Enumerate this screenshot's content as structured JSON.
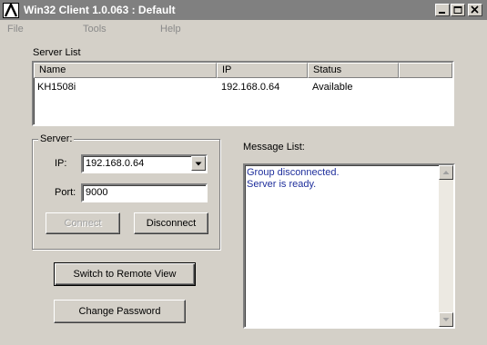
{
  "window": {
    "title": "Win32 Client 1.0.063 : Default"
  },
  "menu": {
    "file": "File",
    "tools": "Tools",
    "help": "Help"
  },
  "server_list": {
    "label": "Server List",
    "columns": [
      "Name",
      "IP",
      "Status"
    ],
    "rows": [
      {
        "name": "KH1508i",
        "ip": "192.168.0.64",
        "status": "Available"
      }
    ]
  },
  "server": {
    "group_label": "Server:",
    "ip_label": "IP:",
    "ip_value": "192.168.0.64",
    "port_label": "Port:",
    "port_value": "9000",
    "connect_label": "Connect",
    "disconnect_label": "Disconnect"
  },
  "buttons": {
    "switch_remote": "Switch to Remote View",
    "change_password": "Change Password"
  },
  "messages": {
    "label": "Message List:",
    "lines": [
      "Group disconnected.",
      "Server is ready."
    ],
    "text_color": "#1f2f9c"
  },
  "icons": [
    "app-logo-icon",
    "minimize-icon",
    "maximize-icon",
    "close-icon",
    "dropdown-arrow-icon",
    "scroll-up-icon",
    "scroll-down-icon"
  ]
}
